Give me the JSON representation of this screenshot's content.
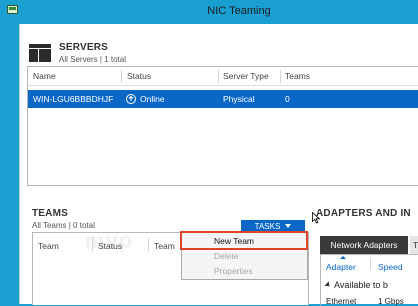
{
  "window": {
    "title": "NIC Teaming",
    "icon": "nic-teaming-icon"
  },
  "servers": {
    "title": "SERVERS",
    "subtitle": "All Servers | 1 total",
    "columns": [
      "Name",
      "Status",
      "Server Type",
      "Teams"
    ],
    "rows": [
      {
        "name": "WIN-LGU6BBBDHJF",
        "status": "Online",
        "server_type": "Physical",
        "teams": "0",
        "selected": true
      }
    ]
  },
  "teams": {
    "title": "TEAMS",
    "subtitle": "All Teams | 0 total",
    "tasks_label": "TASKS",
    "columns": [
      "Team",
      "Status",
      "Team"
    ],
    "menu": [
      "New Team",
      "Delete",
      "Properties"
    ],
    "highlighted_item": "New Team"
  },
  "adapters": {
    "title": "ADAPTERS AND IN",
    "tabs": [
      "Network Adapters",
      "T"
    ],
    "active_tab": "Network Adapters",
    "columns": [
      "Adapter",
      "Speed"
    ],
    "group_label": "Available to b",
    "rows": [
      [
        "Ethernet",
        "1 Gbps"
      ]
    ]
  },
  "colors": {
    "titlebar": "#1a9fd1",
    "selection": "#0a67c5",
    "highlight_box": "#e0432a",
    "active_tab": "#3a3a3a"
  }
}
